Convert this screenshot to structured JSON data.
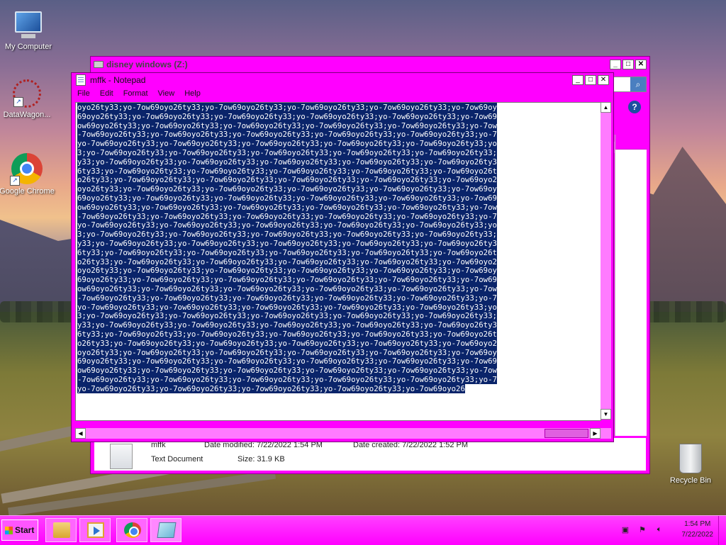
{
  "desktop": {
    "icons": [
      {
        "label": "My Computer"
      },
      {
        "label": "DataWagon..."
      },
      {
        "label": "Google Chrome"
      },
      {
        "label": "Recycle Bin"
      }
    ]
  },
  "explorer": {
    "title": "disney windows (Z:)",
    "side_letter": "B",
    "help_icon": "?",
    "details": {
      "name": "mffk",
      "type": "Text Document",
      "date_modified": "Date modified: 7/22/2022 1:54 PM",
      "date_created": "Date created: 7/22/2022 1:52 PM",
      "size": "Size: 31.9 KB"
    }
  },
  "notepad": {
    "title": "mffk - Notepad",
    "menu": [
      "File",
      "Edit",
      "Format",
      "View",
      "Help"
    ],
    "content_lines": [
      "oyo26ty33;yo-7ow69oyo26ty33;yo-7ow69oyo26ty33;yo-7ow69oyo26ty33;yo-7ow69oyo26ty33;yo-7ow69oy",
      "69oyo26ty33;yo-7ow69oyo26ty33;yo-7ow69oyo26ty33;yo-7ow69oyo26ty33;yo-7ow69oyo26ty33;yo-7ow69",
      "ow69oyo26ty33;yo-7ow69oyo26ty33;yo-7ow69oyo26ty33;yo-7ow69oyo26ty33;yo-7ow69oyo26ty33;yo-7ow",
      "-7ow69oyo26ty33;yo-7ow69oyo26ty33;yo-7ow69oyo26ty33;yo-7ow69oyo26ty33;yo-7ow69oyo26ty33;yo-7",
      "yo-7ow69oyo26ty33;yo-7ow69oyo26ty33;yo-7ow69oyo26ty33;yo-7ow69oyo26ty33;yo-7ow69oyo26ty33;yo",
      "3;yo-7ow69oyo26ty33;yo-7ow69oyo26ty33;yo-7ow69oyo26ty33;yo-7ow69oyo26ty33;yo-7ow69oyo26ty33;",
      "y33;yo-7ow69oyo26ty33;yo-7ow69oyo26ty33;yo-7ow69oyo26ty33;yo-7ow69oyo26ty33;yo-7ow69oyo26ty3",
      "6ty33;yo-7ow69oyo26ty33;yo-7ow69oyo26ty33;yo-7ow69oyo26ty33;yo-7ow69oyo26ty33;yo-7ow69oyo26t",
      "o26ty33;yo-7ow69oyo26ty33;yo-7ow69oyo26ty33;yo-7ow69oyo26ty33;yo-7ow69oyo26ty33;yo-7ow69oyo2",
      "oyo26ty33;yo-7ow69oyo26ty33;yo-7ow69oyo26ty33;yo-7ow69oyo26ty33;yo-7ow69oyo26ty33;yo-7ow69oy",
      "69oyo26ty33;yo-7ow69oyo26ty33;yo-7ow69oyo26ty33;yo-7ow69oyo26ty33;yo-7ow69oyo26ty33;yo-7ow69",
      "ow69oyo26ty33;yo-7ow69oyo26ty33;yo-7ow69oyo26ty33;yo-7ow69oyo26ty33;yo-7ow69oyo26ty33;yo-7ow",
      "-7ow69oyo26ty33;yo-7ow69oyo26ty33;yo-7ow69oyo26ty33;yo-7ow69oyo26ty33;yo-7ow69oyo26ty33;yo-7",
      "yo-7ow69oyo26ty33;yo-7ow69oyo26ty33;yo-7ow69oyo26ty33;yo-7ow69oyo26ty33;yo-7ow69oyo26ty33;yo",
      "3;yo-7ow69oyo26ty33;yo-7ow69oyo26ty33;yo-7ow69oyo26ty33;yo-7ow69oyo26ty33;yo-7ow69oyo26ty33;",
      "y33;yo-7ow69oyo26ty33;yo-7ow69oyo26ty33;yo-7ow69oyo26ty33;yo-7ow69oyo26ty33;yo-7ow69oyo26ty3",
      "6ty33;yo-7ow69oyo26ty33;yo-7ow69oyo26ty33;yo-7ow69oyo26ty33;yo-7ow69oyo26ty33;yo-7ow69oyo26t",
      "o26ty33;yo-7ow69oyo26ty33;yo-7ow69oyo26ty33;yo-7ow69oyo26ty33;yo-7ow69oyo26ty33;yo-7ow69oyo2",
      "oyo26ty33;yo-7ow69oyo26ty33;yo-7ow69oyo26ty33;yo-7ow69oyo26ty33;yo-7ow69oyo26ty33;yo-7ow69oy",
      "69oyo26ty33;yo-7ow69oyo26ty33;yo-7ow69oyo26ty33;yo-7ow69oyo26ty33;yo-7ow69oyo26ty33;yo-7ow69",
      "ow69oyo26ty33;yo-7ow69oyo26ty33;yo-7ow69oyo26ty33;yo-7ow69oyo26ty33;yo-7ow69oyo26ty33;yo-7ow",
      "-7ow69oyo26ty33;yo-7ow69oyo26ty33;yo-7ow69oyo26ty33;yo-7ow69oyo26ty33;yo-7ow69oyo26ty33;yo-7",
      "yo-7ow69oyo26ty33;yo-7ow69oyo26ty33;yo-7ow69oyo26ty33;yo-7ow69oyo26ty33;yo-7ow69oyo26ty33;yo",
      "3;yo-7ow69oyo26ty33;yo-7ow69oyo26ty33;yo-7ow69oyo26ty33;yo-7ow69oyo26ty33;yo-7ow69oyo26ty33;",
      "y33;yo-7ow69oyo26ty33;yo-7ow69oyo26ty33;yo-7ow69oyo26ty33;yo-7ow69oyo26ty33;yo-7ow69oyo26ty3",
      "6ty33;yo-7ow69oyo26ty33;yo-7ow69oyo26ty33;yo-7ow69oyo26ty33;yo-7ow69oyo26ty33;yo-7ow69oyo26t",
      "o26ty33;yo-7ow69oyo26ty33;yo-7ow69oyo26ty33;yo-7ow69oyo26ty33;yo-7ow69oyo26ty33;yo-7ow69oyo2",
      "oyo26ty33;yo-7ow69oyo26ty33;yo-7ow69oyo26ty33;yo-7ow69oyo26ty33;yo-7ow69oyo26ty33;yo-7ow69oy",
      "69oyo26ty33;yo-7ow69oyo26ty33;yo-7ow69oyo26ty33;yo-7ow69oyo26ty33;yo-7ow69oyo26ty33;yo-7ow69",
      "ow69oyo26ty33;yo-7ow69oyo26ty33;yo-7ow69oyo26ty33;yo-7ow69oyo26ty33;yo-7ow69oyo26ty33;yo-7ow",
      "-7ow69oyo26ty33;yo-7ow69oyo26ty33;yo-7ow69oyo26ty33;yo-7ow69oyo26ty33;yo-7ow69oyo26ty33;yo-7",
      "yo-7ow69oyo26ty33;yo-7ow69oyo26ty33;yo-7ow69oyo26ty33;yo-7ow69oyo26ty33;yo-7ow69oyo26"
    ]
  },
  "taskbar": {
    "start_label": "Start",
    "clock_time": "1:54 PM",
    "clock_date": "7/22/2022"
  },
  "theme": {
    "window_color": "#ff00ff",
    "selection_color": "#0a246a"
  }
}
